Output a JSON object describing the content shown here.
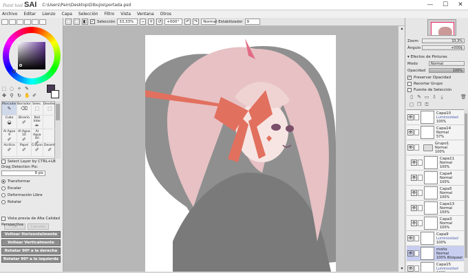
{
  "window": {
    "logo_small": "Paint tool",
    "logo_big": "SAI",
    "path": "C:\\Users\\Pain\\Desktop\\Dibujos\\portada.psd",
    "minimize": "—",
    "maximize": "☐",
    "close": "✕"
  },
  "menu": [
    "Archivo",
    "Editar",
    "Lienzo",
    "Capa",
    "Selección",
    "Filtro",
    "Vista",
    "Ventana",
    "Otros"
  ],
  "toolbar": {
    "selection_label": "Selección",
    "zoom": "33,33%",
    "rotation": "+000°",
    "blend_mode": "Normal",
    "stabilizer_label": "Estabilizador",
    "stabilizer_value": "9"
  },
  "colors": {
    "foreground": "#4a3a55",
    "background": "#ffffff",
    "accent": "#e26b85"
  },
  "tools": {
    "row1": [
      "marquee-icon",
      "lasso-icon",
      "magic-wand-icon",
      "eyedropper-icon"
    ],
    "row2": [
      "move-icon",
      "zoom-icon",
      "rotate-icon",
      "hand-icon",
      "picker-icon"
    ]
  },
  "brushes": [
    {
      "label": "Marcador",
      "icon": "✎"
    },
    {
      "label": "Borrador",
      "icon": "⌫"
    },
    {
      "label": "Selec.",
      "icon": "⬚"
    },
    {
      "label": "Deselec.",
      "icon": "⬚"
    },
    {
      "label": "Cubo",
      "icon": "◒"
    },
    {
      "label": "Binario",
      "icon": "✐"
    },
    {
      "label": "Boli Inter",
      "icon": "✒"
    },
    {
      "label": "",
      "icon": ""
    },
    {
      "label": "Al Agua 9",
      "icon": "✐"
    },
    {
      "label": "Al Agua 10",
      "icon": "✐"
    },
    {
      "label": "Al Agua Oil",
      "icon": "✐"
    },
    {
      "label": "",
      "icon": ""
    },
    {
      "label": "Acrilico",
      "icon": "✐"
    },
    {
      "label": "Papel",
      "icon": "✐"
    },
    {
      "label": "Crayon",
      "icon": "✐"
    },
    {
      "label": "Desenf.",
      "icon": "✐"
    }
  ],
  "options": {
    "select_layer": "Select Layer by CTRL+LB",
    "drag_detection": "Drag Detection Pix:",
    "drag_value": "8 pix",
    "transform": "Transformar",
    "scale": "Escalar",
    "free_deform": "Deformación Libre",
    "rotate": "Rotatar",
    "ok": "OK",
    "cancel": "Cancelar",
    "hq_preview": "Vista previa de Alta Calidad",
    "perspective": "Perspectiva",
    "flip_h": "Voltear Horizontalmente",
    "flip_v": "Voltear Verticalmente",
    "rot_right": "Rotatar 90º a la derecha",
    "rot_left": "Rotatar 90º a la izquierda"
  },
  "right": {
    "zoom_label": "Zoom",
    "zoom_value": "33,3%",
    "angle_label": "Ángulo",
    "angle_value": "+000$",
    "effects_header": "Efectos de Pinturas",
    "mode_label": "Modo",
    "mode_value": "Normal",
    "opacity_label": "Opacidad",
    "opacity_value": "100%",
    "preserve_opacity": "Preservar Opacidad",
    "clip_group": "Recortar Grupo",
    "selection_source": "Fuente de Selección"
  },
  "layers": [
    {
      "name": "Capa10",
      "mode": "Luminosidad",
      "opacity": "100%",
      "indent": false,
      "selected": false,
      "folder": false
    },
    {
      "name": "Capa14",
      "mode": "Normal",
      "opacity": "57%",
      "indent": false,
      "selected": false,
      "folder": false
    },
    {
      "name": "Grupo1",
      "mode": "Normal",
      "opacity": "100%",
      "indent": false,
      "selected": false,
      "folder": true
    },
    {
      "name": "Capa11",
      "mode": "Normal",
      "opacity": "100%",
      "indent": true,
      "selected": false,
      "folder": false
    },
    {
      "name": "Capa4",
      "mode": "Normal",
      "opacity": "100%",
      "indent": true,
      "selected": false,
      "folder": false
    },
    {
      "name": "Capa5",
      "mode": "Normal",
      "opacity": "100%",
      "indent": true,
      "selected": false,
      "folder": false
    },
    {
      "name": "Capa13",
      "mode": "Normal",
      "opacity": "100%",
      "indent": true,
      "selected": false,
      "folder": false
    },
    {
      "name": "Capa3",
      "mode": "Normal",
      "opacity": "100%",
      "indent": true,
      "selected": false,
      "folder": false
    },
    {
      "name": "Capa9",
      "mode": "Luminosidad",
      "opacity": "100%",
      "indent": false,
      "selected": false,
      "folder": false
    },
    {
      "name": "moño",
      "mode": "Normal",
      "opacity": "100% Bloquear",
      "indent": false,
      "selected": true,
      "folder": false
    },
    {
      "name": "Capa15",
      "mode": "Luminosidad",
      "opacity": "100%",
      "indent": false,
      "selected": false,
      "folder": false
    }
  ]
}
